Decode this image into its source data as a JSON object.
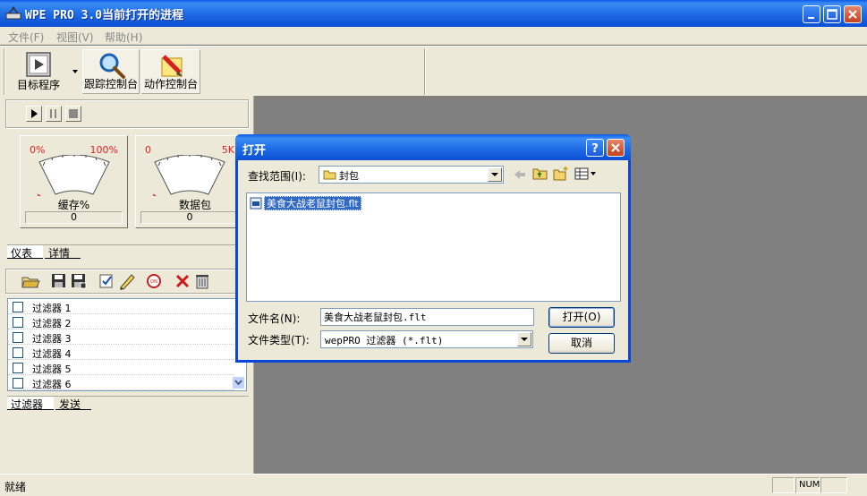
{
  "window": {
    "title": "WPE PRO 3.0当前打开的进程",
    "icons": {
      "app": "wpe-app-icon",
      "minimize": "minimize-icon",
      "maximize": "maximize-icon",
      "close": "close-icon"
    }
  },
  "menu": {
    "items": [
      {
        "label": "文件(F)"
      },
      {
        "label": "视图(V)"
      },
      {
        "label": "帮助(H)"
      }
    ]
  },
  "toolbar": {
    "target_program": "目标程序",
    "trace_console": "跟踪控制台",
    "action_console": "动作控制台"
  },
  "gauges": {
    "buffer": {
      "min": "0%",
      "max": "100%",
      "name": "缓存%",
      "value": "0",
      "level": 0
    },
    "packets": {
      "min": "0",
      "max": "5K",
      "name": "数据包",
      "value": "0",
      "level": 0
    }
  },
  "upper_tabs": [
    "仪表",
    "详情"
  ],
  "filters": {
    "items": [
      {
        "label": "过滤器 1",
        "checked": false
      },
      {
        "label": "过滤器 2",
        "checked": false
      },
      {
        "label": "过滤器 3",
        "checked": false
      },
      {
        "label": "过滤器 4",
        "checked": false
      },
      {
        "label": "过滤器 5",
        "checked": false
      },
      {
        "label": "过滤器 6",
        "checked": false
      }
    ]
  },
  "lower_tabs": [
    "过滤器",
    "发送"
  ],
  "status": {
    "text": "就绪",
    "num": "NUM"
  },
  "dialog": {
    "title": "打开",
    "look_in_label": "查找范围(I):",
    "look_in_value": "封包",
    "file": "美食大战老鼠封包.flt",
    "filename_label": "文件名(N):",
    "filename_value": "美食大战老鼠封包.flt",
    "filetype_label": "文件类型(T):",
    "filetype_value": "wepPRO 过滤器 (*.flt)",
    "open_button": "打开(O)",
    "cancel_button": "取消"
  },
  "colors": {
    "titlebar": "#0a5ae8",
    "face": "#ece9d8",
    "workspace": "#808080",
    "selection": "#316ac5",
    "gauge_label": "#e02020"
  }
}
